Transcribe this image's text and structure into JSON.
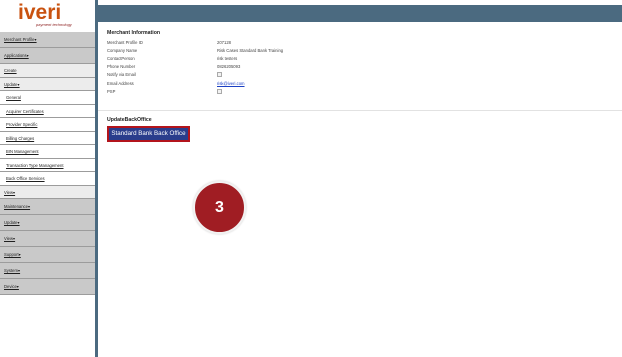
{
  "logo": {
    "wordmark": "iveri",
    "tagline": "payment technology"
  },
  "nav": [
    {
      "label": "Merchant Profile▾",
      "level": "top"
    },
    {
      "label": "Applications▾",
      "level": "top"
    },
    {
      "label": "Create",
      "level": "sub"
    },
    {
      "label": "Update▾",
      "level": "sub"
    },
    {
      "label": "General",
      "level": "child"
    },
    {
      "label": "Acquirer Certificates",
      "level": "child"
    },
    {
      "label": "Provider Specific",
      "level": "child"
    },
    {
      "label": "Billing Charges",
      "level": "child"
    },
    {
      "label": "BIN Management",
      "level": "child"
    },
    {
      "label": "Transaction Type Management",
      "level": "child"
    },
    {
      "label": "Back Office Services",
      "level": "child"
    },
    {
      "label": "View▾",
      "level": "sub"
    },
    {
      "label": "Maintenance▾",
      "level": "top"
    },
    {
      "label": "Update▾",
      "level": "top"
    },
    {
      "label": "View▾",
      "level": "top"
    },
    {
      "label": "Support▾",
      "level": "top"
    },
    {
      "label": "System▾",
      "level": "top"
    },
    {
      "label": "Device▾",
      "level": "top"
    }
  ],
  "merchant": {
    "title": "Merchant Information",
    "rows": [
      {
        "label": "Merchant Profile ID",
        "value": "207128"
      },
      {
        "label": "Company Name",
        "value": "Risk Cases Standard Bank Training"
      },
      {
        "label": "ContactPerson",
        "value": "risk testers"
      },
      {
        "label": "Phone Number",
        "value": "0826205093"
      },
      {
        "label": "Notify via Email",
        "value": ""
      },
      {
        "label": "Email Address",
        "value": "risk@iveri.com"
      },
      {
        "label": "PSP",
        "value": ""
      }
    ]
  },
  "update_back_office": {
    "title": "UpdateBackOffice",
    "button_label": "Standard Bank Back Office"
  },
  "step_marker": "3",
  "colors": {
    "header_bar": "#4b6a80",
    "button_bg": "#2a3d8c",
    "button_border": "#b3141c",
    "step_marker": "#a01d23",
    "logo": "#c9520f"
  }
}
